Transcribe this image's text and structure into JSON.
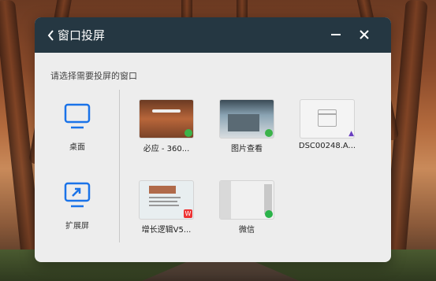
{
  "header": {
    "title": "窗口投屏"
  },
  "subtitle": "请选择需要投屏的窗口",
  "side_items": [
    {
      "label": "桌面",
      "icon": "monitor-icon"
    },
    {
      "label": "扩展屏",
      "icon": "extend-screen-icon"
    }
  ],
  "windows": [
    {
      "label": "必应 - 360...",
      "icon": "bing-thumbnail"
    },
    {
      "label": "图片查看",
      "icon": "image-viewer-thumbnail"
    },
    {
      "label": "DSC00248.A...",
      "icon": "file-thumbnail"
    },
    {
      "label": "增长逻辑V5...",
      "icon": "wps-document-thumbnail"
    },
    {
      "label": "微信",
      "icon": "wechat-thumbnail"
    }
  ],
  "colors": {
    "titlebar": "#253742",
    "accent": "#1a73e8",
    "dialog_bg": "#ededed"
  }
}
